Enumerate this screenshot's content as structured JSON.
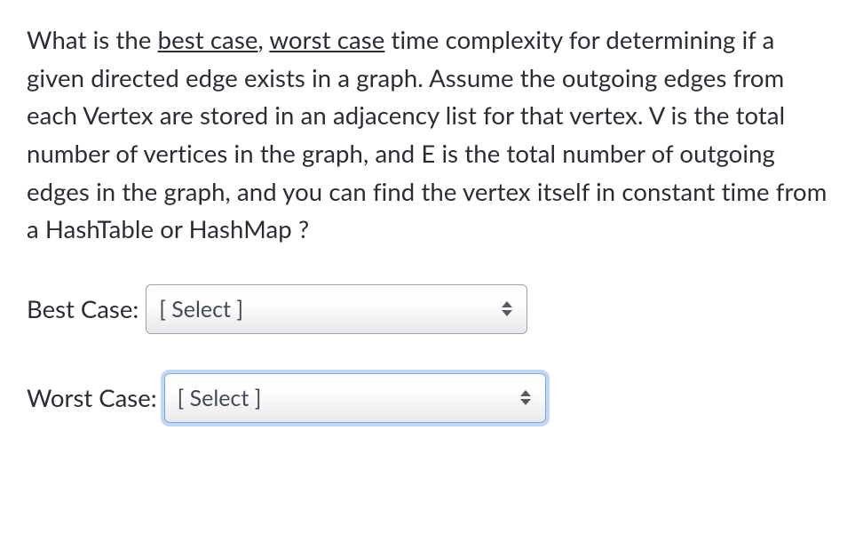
{
  "question": {
    "pre": "What is the ",
    "u1": "best case",
    "mid1": ", ",
    "u2": "worst case",
    "post": " time complexity for determining if a given directed edge exists in a graph.  Assume the outgoing edges from each Vertex are stored in an adjacency list for that vertex.  V is the total number of vertices in the graph, and E is the total number of outgoing edges in the graph, and you can find the vertex itself in constant time from a HashTable or HashMap ?"
  },
  "rows": {
    "best": {
      "label": "Best Case:",
      "select_placeholder": "[ Select ]"
    },
    "worst": {
      "label": "Worst Case:",
      "select_placeholder": "[ Select ]"
    }
  }
}
